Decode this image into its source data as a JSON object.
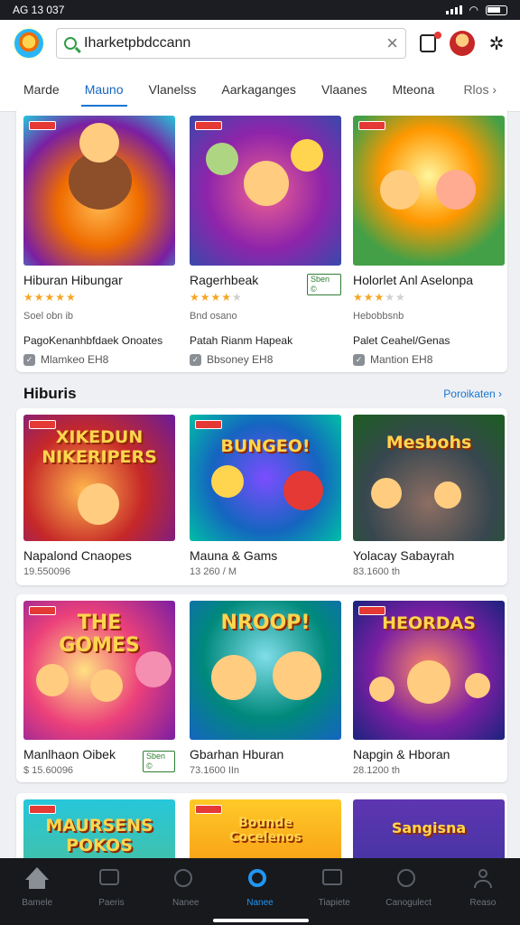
{
  "status": {
    "time": "AG 13 037"
  },
  "search": {
    "value": "Iharketpbdccann"
  },
  "tabs": [
    {
      "label": "Marde"
    },
    {
      "label": "Mauno",
      "active": true
    },
    {
      "label": "Vlanelss"
    },
    {
      "label": "Aarkaganges"
    },
    {
      "label": "Vlaanes"
    },
    {
      "label": "Mteona"
    },
    {
      "label": "Rlos ›"
    }
  ],
  "featured": [
    {
      "name": "Hiburan Hibungar",
      "rating": 5,
      "sub": "Soel obn ib",
      "info": "PagoKenanhbfdaek Onoates",
      "developer": "Mlamkeo EH8",
      "badge": ""
    },
    {
      "name": "Ragerhbeak",
      "rating": 4,
      "sub": "Bnd osano",
      "info": "Patah Rianm Hapeak",
      "developer": "Bbsoney EH8",
      "badge": "Sben ©"
    },
    {
      "name": "Holorlet Anl Aselonpa",
      "rating": 3,
      "sub": "Hebobbsnb",
      "info": "Palet Ceahel/Genas",
      "developer": "Mantion EH8",
      "badge": ""
    }
  ],
  "section": {
    "title": "Hiburis",
    "link": "Poroikaten ›"
  },
  "games": [
    {
      "name": "Napalond Cnaopes",
      "meta": "19.550096",
      "art": "XIKEDUN NIKERIPERS"
    },
    {
      "name": "Mauna & Gams",
      "meta": "13 260 / M",
      "art": "BUNGEO!"
    },
    {
      "name": "Yolacay Sabayrah",
      "meta": "83.1600 th",
      "art": "Mesbohs"
    },
    {
      "name": "Manlhaon Oibek",
      "meta": "$ 15.60096",
      "art": "THE GOMES",
      "badge": "Sben ©"
    },
    {
      "name": "Gbarhan Hburan",
      "meta": "73.1600 IIn",
      "art": "NROOP!"
    },
    {
      "name": "Napgin & Hboran",
      "meta": "28.1200 th",
      "art": "HEORDAS"
    },
    {
      "name": "",
      "meta": "",
      "art": "MAURSENS POKOS"
    },
    {
      "name": "",
      "meta": "",
      "art": "Bounde Cocelenos"
    },
    {
      "name": "",
      "meta": "",
      "art": "Sangisna"
    }
  ],
  "nav": [
    {
      "label": "Bamele",
      "icon": "home-icon"
    },
    {
      "label": "Paeris",
      "icon": "chat-icon"
    },
    {
      "label": "Nanee",
      "icon": "explore-icon"
    },
    {
      "label": "Nanee",
      "icon": "search-icon",
      "active": true
    },
    {
      "label": "Tiapiete",
      "icon": "inbox-icon"
    },
    {
      "label": "Canogulect",
      "icon": "magnifier-icon"
    },
    {
      "label": "Reaso",
      "icon": "profile-icon"
    }
  ]
}
